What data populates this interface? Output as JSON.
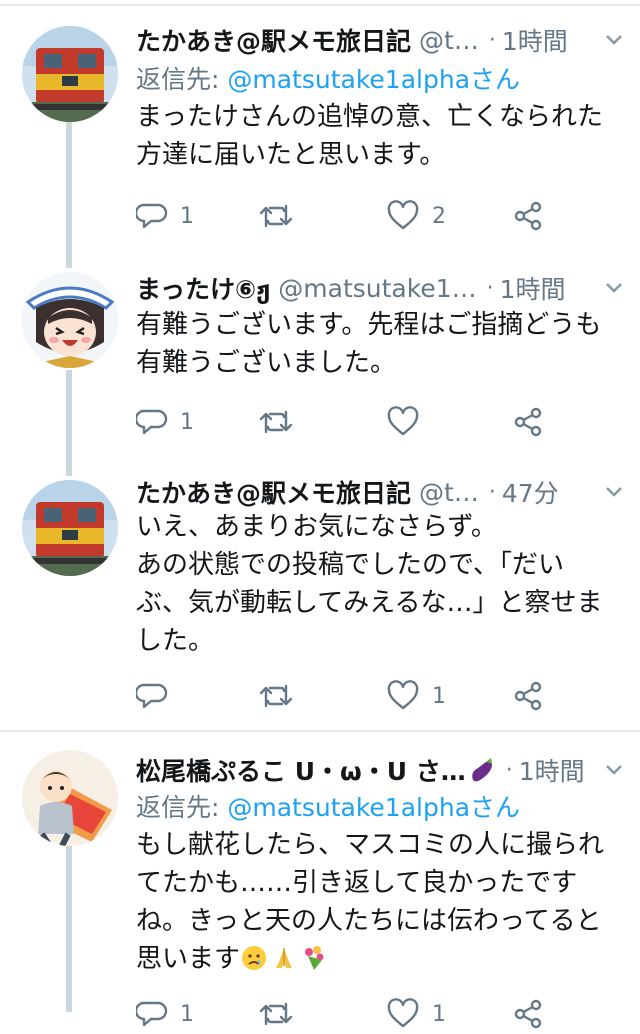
{
  "tweets": [
    {
      "name": "たかあき@駅メモ旅日記",
      "handle": "@t…",
      "time": "1時間",
      "reply_label": "返信先: ",
      "reply_to": "@matsutake1alphaさん",
      "text": "まったけさんの追悼の意、亡くなられた\n方達に届いたと思います。",
      "replies": "1",
      "retweets": "",
      "likes": "2"
    },
    {
      "name": "まったけ⑥ჟ",
      "handle": "@matsutake1…",
      "time": "1時間",
      "text": "有難うございます。先程はご指摘どうも\n有難うございました。",
      "replies": "1",
      "retweets": "",
      "likes": ""
    },
    {
      "name": "たかあき@駅メモ旅日記",
      "handle": "@t…",
      "time": "47分",
      "text": "いえ、あまりお気になさらず。\nあの状態での投稿でしたので、「だい\nぶ、気が動転してみえるな…」と察せま\nした。",
      "replies": "",
      "retweets": "",
      "likes": "1"
    },
    {
      "name": "松尾橋ぷるこ U・ω・U さ…",
      "handle": "",
      "time": "1時間",
      "reply_label": "返信先: ",
      "reply_to": "@matsutake1alphaさん",
      "text": "もし献花したら、マスコミの人に撮られ\nてたかも……引き返して良かったです\nね。きっと天の人たちには伝わってると\n思います",
      "replies": "1",
      "retweets": "",
      "likes": "1"
    }
  ],
  "colors": {
    "text": "#14171a",
    "secondary": "#657786",
    "link": "#1da1f2",
    "divider": "#e1e8ed",
    "thread": "#ccd6dd"
  },
  "icons": [
    "reply-icon",
    "retweet-icon",
    "like-icon",
    "share-icon",
    "chevron-down-icon",
    "eggplant-emoji",
    "crying-emoji",
    "folded-hands-emoji",
    "bouquet-emoji"
  ]
}
